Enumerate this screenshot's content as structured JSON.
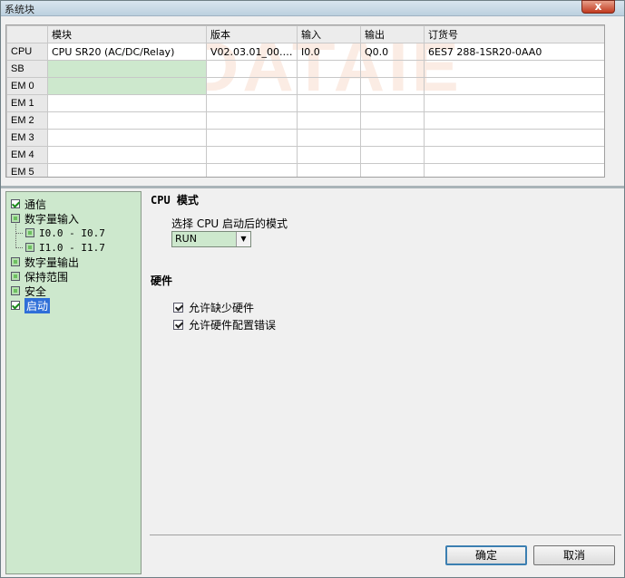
{
  "window": {
    "title": "系统块",
    "close_label": "x"
  },
  "grid": {
    "watermark": "DATAIE",
    "columns": [
      "",
      "模块",
      "版本",
      "输入",
      "输出",
      "订货号"
    ],
    "rows": [
      {
        "slot": "CPU",
        "module": "CPU SR20 (AC/DC/Relay)",
        "version": "V02.03.01_00.00...",
        "input": "I0.0",
        "output": "Q0.0",
        "order": "6ES7 288-1SR20-0AA0"
      },
      {
        "slot": "SB",
        "module": "",
        "version": "",
        "input": "",
        "output": "",
        "order": ""
      },
      {
        "slot": "EM 0",
        "module": "",
        "version": "",
        "input": "",
        "output": "",
        "order": ""
      },
      {
        "slot": "EM 1",
        "module": "",
        "version": "",
        "input": "",
        "output": "",
        "order": ""
      },
      {
        "slot": "EM 2",
        "module": "",
        "version": "",
        "input": "",
        "output": "",
        "order": ""
      },
      {
        "slot": "EM 3",
        "module": "",
        "version": "",
        "input": "",
        "output": "",
        "order": ""
      },
      {
        "slot": "EM 4",
        "module": "",
        "version": "",
        "input": "",
        "output": "",
        "order": ""
      },
      {
        "slot": "EM 5",
        "module": "",
        "version": "",
        "input": "",
        "output": "",
        "order": ""
      }
    ]
  },
  "tree": {
    "items": [
      {
        "label": "通信",
        "checked": true
      },
      {
        "label": "数字量输入",
        "checked": false
      },
      {
        "label": "I0.0 - I0.7",
        "checked": false
      },
      {
        "label": "I1.0 - I1.7",
        "checked": false
      },
      {
        "label": "数字量输出",
        "checked": false
      },
      {
        "label": "保持范围",
        "checked": false
      },
      {
        "label": "安全",
        "checked": false
      },
      {
        "label": "启动",
        "checked": true
      }
    ]
  },
  "panel": {
    "cpu_mode_title": "CPU 模式",
    "cpu_mode_label": "选择 CPU 启动后的模式",
    "cpu_mode_value": "RUN",
    "hardware_title": "硬件",
    "allow_missing": "允许缺少硬件",
    "allow_config_error": "允许硬件配置错误",
    "ok_label": "确定",
    "cancel_label": "取消"
  }
}
